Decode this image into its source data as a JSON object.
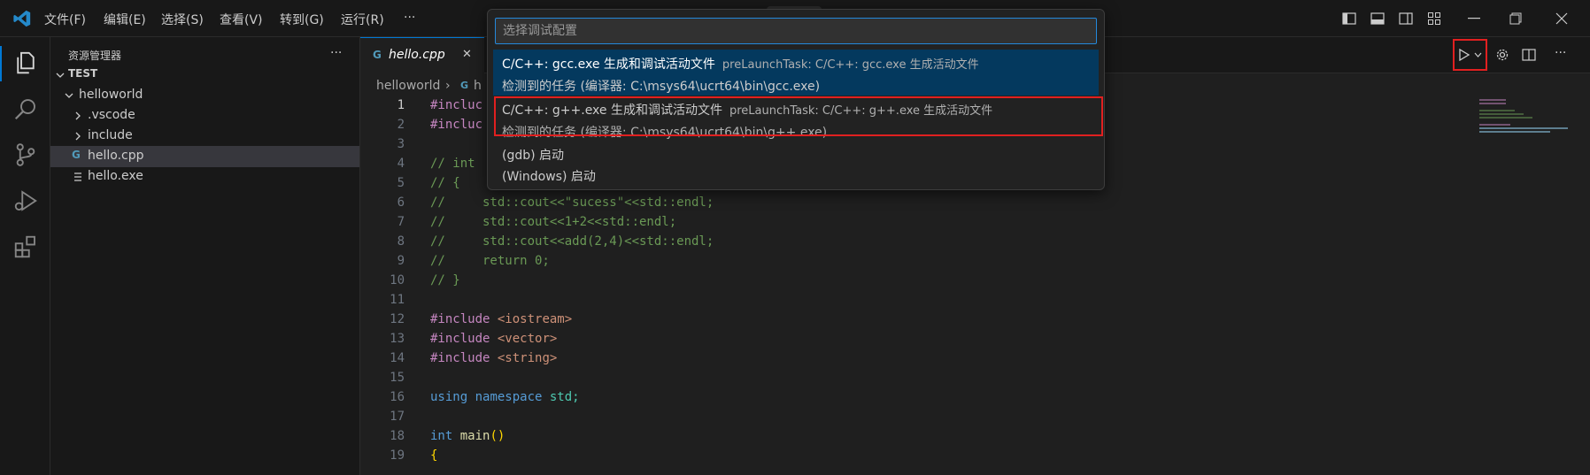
{
  "menu": [
    "文件(F)",
    "编辑(E)",
    "选择(S)",
    "查看(V)",
    "转到(G)",
    "运行(R)",
    "···"
  ],
  "sidebar": {
    "title": "资源管理器",
    "more": "···",
    "root": "TEST",
    "folder": "helloworld",
    "items": [
      ".vscode",
      "include",
      "hello.cpp",
      "hello.exe"
    ]
  },
  "tab": {
    "label": "hello.cpp",
    "close": "✕"
  },
  "breadcrumb": {
    "folder": "helloworld",
    "sep": "›",
    "file": "h"
  },
  "quickpick": {
    "placeholder": "选择调试配置",
    "options": [
      {
        "title": "C/C++: gcc.exe 生成和调试活动文件",
        "detail": "preLaunchTask: C/C++: gcc.exe 生成活动文件",
        "desc": "检测到的任务 (编译器: C:\\msys64\\ucrt64\\bin\\gcc.exe)"
      },
      {
        "title": "C/C++: g++.exe 生成和调试活动文件",
        "detail": "preLaunchTask: C/C++: g++.exe 生成活动文件",
        "desc": "检测到的任务 (编译器: C:\\msys64\\ucrt64\\bin\\g++.exe)"
      },
      {
        "title": "(gdb) 启动"
      },
      {
        "title": "(Windows) 启动"
      }
    ]
  },
  "code": {
    "line_numbers": [
      "1",
      "2",
      "3",
      "4",
      "5",
      "6",
      "7",
      "8",
      "9",
      "10",
      "11",
      "12",
      "13",
      "14",
      "15",
      "16",
      "17",
      "18",
      "19"
    ],
    "l1": "#incluc",
    "l2": "#incluc",
    "l4": "// int",
    "l5": "// {",
    "l6": "//     std::cout<<\"sucess\"<<std::endl;",
    "l7": "//     std::cout<<1+2<<std::endl;",
    "l8": "//     std::cout<<add(2,4)<<std::endl;",
    "l9": "//     return 0;",
    "l10": "// }",
    "l12a": "#include",
    "l12b": " <iostream>",
    "l13a": "#include",
    "l13b": " <vector>",
    "l14a": "#include",
    "l14b": " <string>",
    "l16a": "using",
    "l16b": " namespace",
    "l16c": " std;",
    "l18a": "int",
    "l18b": " main",
    "l18c": "()",
    "l19": "{"
  },
  "colors": {
    "accent": "#0078d4",
    "highlight_box": "#e12020",
    "selected_option": "#04395e"
  }
}
